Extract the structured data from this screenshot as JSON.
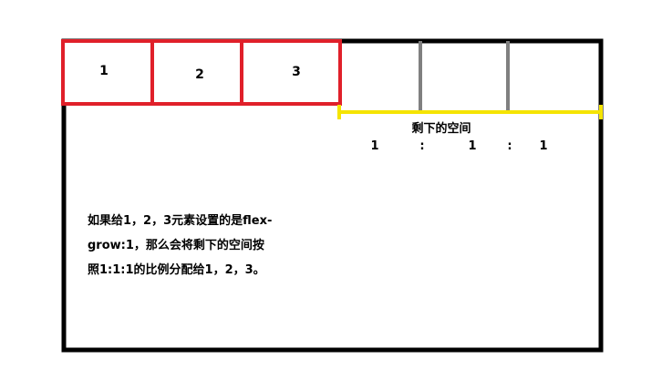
{
  "diagram": {
    "items": [
      {
        "label": "1"
      },
      {
        "label": "2"
      },
      {
        "label": "3"
      }
    ],
    "remaining_space_label": "剩下的空间",
    "ratio": [
      "1",
      ":",
      "1",
      ":",
      "1"
    ],
    "note": "如果给1，2，3元素设置的是flex-\ngrow:1，那么会将剩下的空间按\n照1:1:1的比例分配给1，2，3。",
    "colors": {
      "container_border": "#000000",
      "item_border": "#e0202a",
      "remaining_bracket": "#f5e400",
      "divider": "#808080"
    }
  }
}
